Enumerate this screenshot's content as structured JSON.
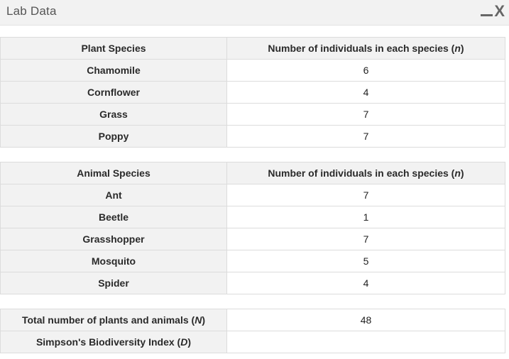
{
  "window": {
    "title": "Lab Data",
    "close_label": "X"
  },
  "plants": {
    "header_species": "Plant Species",
    "header_count_prefix": "Number of individuals in each species (",
    "header_count_var": "n",
    "header_count_suffix": ")",
    "rows": [
      {
        "species": "Chamomile",
        "count": "6"
      },
      {
        "species": "Cornflower",
        "count": "4"
      },
      {
        "species": "Grass",
        "count": "7"
      },
      {
        "species": "Poppy",
        "count": "7"
      }
    ]
  },
  "animals": {
    "header_species": "Animal Species",
    "header_count_prefix": "Number of individuals in each species (",
    "header_count_var": "n",
    "header_count_suffix": ")",
    "rows": [
      {
        "species": "Ant",
        "count": "7"
      },
      {
        "species": "Beetle",
        "count": "1"
      },
      {
        "species": "Grasshopper",
        "count": "7"
      },
      {
        "species": "Mosquito",
        "count": "5"
      },
      {
        "species": "Spider",
        "count": "4"
      }
    ]
  },
  "summary": {
    "total_label_prefix": "Total number of plants and animals (",
    "total_label_var": "N",
    "total_label_suffix": ")",
    "total_value": "48",
    "index_label_prefix": "Simpson's Biodiversity Index (",
    "index_label_var": "D",
    "index_label_suffix": ")",
    "index_value": ""
  }
}
